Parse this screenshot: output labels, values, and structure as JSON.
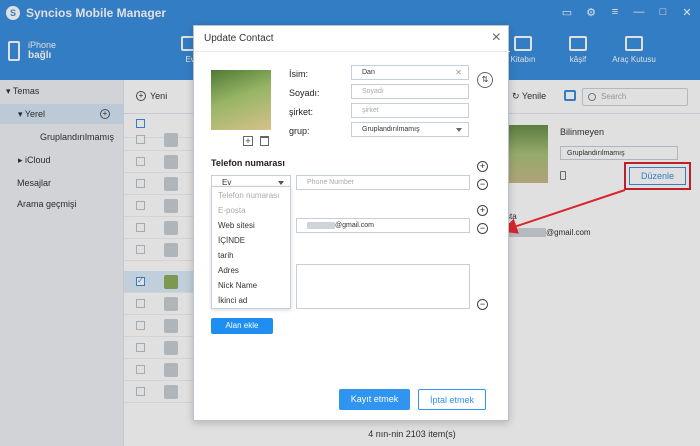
{
  "app": {
    "title": "Syncios Mobile Manager",
    "logo_letter": "S",
    "accent": "#3b8fe0",
    "window_controls": [
      {
        "icon": "chat-icon",
        "glyph": "▭"
      },
      {
        "icon": "gear-icon",
        "glyph": "⚙"
      },
      {
        "icon": "menu-icon",
        "glyph": "≡"
      },
      {
        "icon": "minimize-icon",
        "glyph": "—"
      },
      {
        "icon": "maximize-icon",
        "glyph": "□"
      },
      {
        "icon": "close-icon",
        "glyph": "✕"
      }
    ]
  },
  "device": {
    "name": "iPhone",
    "status": "bağlı"
  },
  "nav": {
    "tabs": [
      {
        "label": "Ev",
        "icon": "home-icon"
      },
      {
        "label": "Kitabın",
        "icon": "book-icon"
      },
      {
        "label": "kâşif",
        "icon": "folder-icon"
      },
      {
        "label": "Araç Kutusu",
        "icon": "toolbox-icon"
      }
    ]
  },
  "sidebar": {
    "items": [
      {
        "label": "Temas",
        "prefix": "▾"
      },
      {
        "label": "Yerel",
        "prefix": "▾"
      },
      {
        "label": "Gruplandırılmamış",
        "prefix": ""
      },
      {
        "label": "iCloud",
        "prefix": "▸"
      },
      {
        "label": "Mesajlar",
        "prefix": ""
      },
      {
        "label": "Arama geçmişi",
        "prefix": ""
      }
    ]
  },
  "toolbar": {
    "new_label": "Yeni",
    "refresh_label": "Yenile",
    "search_placeholder": "Search"
  },
  "detail": {
    "name": "Bilinmeyen",
    "group": "Gruplandırılmamış",
    "edit_label": "Düzenle",
    "email_label": "sta",
    "email_value": "@gmail.com",
    "highlight_color": "#d9262b"
  },
  "status": {
    "count_text": "4 nın-nin 2103 item(s)"
  },
  "modal": {
    "title": "Update Contact",
    "close_glyph": "×",
    "fields": [
      {
        "label": "İsim:",
        "value": "Dan",
        "placeholder": ""
      },
      {
        "label": "Soyadı:",
        "value": "",
        "placeholder": "Soyadı"
      },
      {
        "label": "şirket:",
        "value": "",
        "placeholder": "şirket"
      },
      {
        "label": "grup:",
        "value": "Gruplandırılmamış",
        "placeholder": ""
      }
    ],
    "phone_section": "Telefon numarası",
    "phone_type": "Ev",
    "phone_placeholder": "Phone Number",
    "email_value": "@gmail.com",
    "dropdown_options": [
      {
        "label": "Telefon numarası",
        "muted": true
      },
      {
        "label": "E-posta",
        "muted": true
      },
      {
        "label": "Web sitesi",
        "muted": false
      },
      {
        "label": "İÇİNDE",
        "muted": false
      },
      {
        "label": "tarih",
        "muted": false
      },
      {
        "label": "Adres",
        "muted": false
      },
      {
        "label": "Nick Name",
        "muted": false
      },
      {
        "label": "İkinci ad",
        "muted": false
      }
    ],
    "add_field_label": "Alan ekle",
    "save_label": "Kayıt etmek",
    "cancel_label": "İptal etmek"
  }
}
